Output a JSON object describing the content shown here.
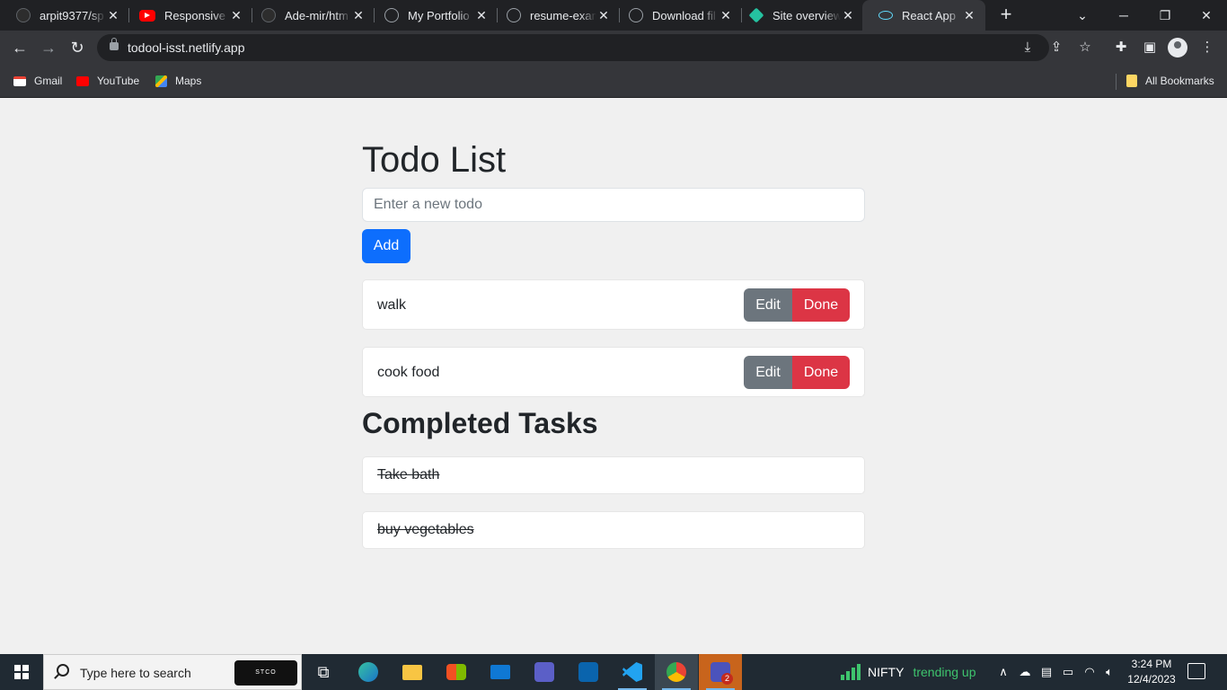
{
  "browser": {
    "tabs": [
      {
        "title": "arpit9377/sp",
        "icon": "github-icon"
      },
      {
        "title": "Responsive P",
        "icon": "youtube-icon"
      },
      {
        "title": "Ade-mir/htm",
        "icon": "github-icon"
      },
      {
        "title": "My Portfolio",
        "icon": "globe-icon"
      },
      {
        "title": "resume-exam",
        "icon": "globe-icon"
      },
      {
        "title": "Download fil",
        "icon": "globe-icon"
      },
      {
        "title": "Site overview",
        "icon": "netlify-icon"
      },
      {
        "title": "React App",
        "icon": "react-icon",
        "active": true
      }
    ],
    "url": "todool-isst.netlify.app",
    "bookmarks": [
      {
        "label": "Gmail",
        "icon": "gmail-icon"
      },
      {
        "label": "YouTube",
        "icon": "youtube-icon"
      },
      {
        "label": "Maps",
        "icon": "maps-icon"
      }
    ],
    "all_bookmarks_label": "All Bookmarks"
  },
  "app": {
    "title": "Todo List",
    "input": {
      "placeholder": "Enter a new todo",
      "value": ""
    },
    "add_label": "Add",
    "todos": [
      {
        "text": "walk",
        "edit_label": "Edit",
        "done_label": "Done"
      },
      {
        "text": "cook food",
        "edit_label": "Edit",
        "done_label": "Done"
      }
    ],
    "completed_title": "Completed Tasks",
    "completed": [
      {
        "text": "Take bath"
      },
      {
        "text": "buy vegetables"
      }
    ],
    "colors": {
      "primary": "#0d6efd",
      "secondary": "#6c757d",
      "danger": "#dc3545",
      "background": "#f0f0f0"
    }
  },
  "taskbar": {
    "search_placeholder": "Type here to search",
    "promo_text": "STCO",
    "nifty_label": "NIFTY",
    "nifty_status": "trending up",
    "time": "3:24 PM",
    "date": "12/4/2023",
    "teams_badge": "2"
  }
}
